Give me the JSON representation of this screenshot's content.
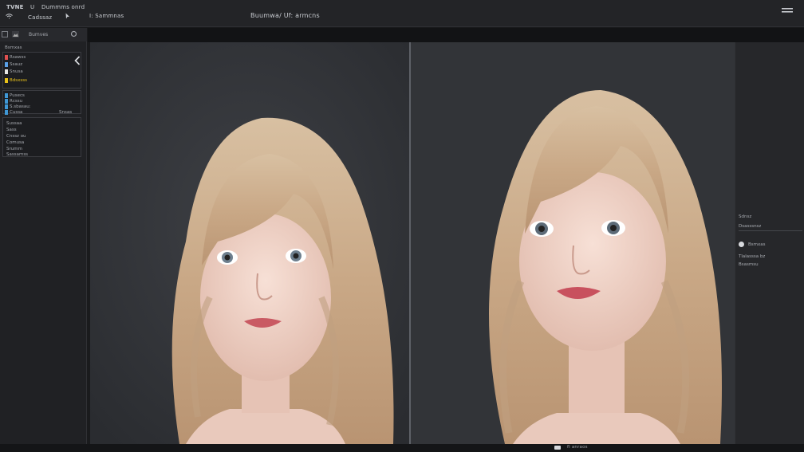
{
  "topbar": {
    "app_name": "TVNE",
    "menu_u": "U",
    "menu_title": "Dummms onrd",
    "sub_label": "Cadssaz",
    "tool_label": "I: Sammnas",
    "doc_title": "Buumwa/ Uf: armcns",
    "menu_icon": "hamburger-menu-icon"
  },
  "left_panel": {
    "header_label": "Bumves",
    "section_label": "Bsmxas",
    "layers": [
      {
        "label": "Rsawss",
        "color": "#e05050"
      },
      {
        "label": "Ssauz",
        "color": "#5aa0e6"
      },
      {
        "label": "Snusa",
        "color": "#e6e6e6"
      },
      {
        "label": "Bdsxsss",
        "color": "#e8c21a"
      },
      {
        "label": "Pusecs",
        "color": "#3f98d6"
      },
      {
        "label": "Rcssu",
        "color": "#3f98d6"
      },
      {
        "label": "S.sbasau:",
        "color": "#3f98d6"
      },
      {
        "label": "Cussa",
        "color": "#3f98d6"
      }
    ],
    "right_value": "Snsas",
    "props": [
      "Sussaa",
      "Sass",
      "Cnssz  ou",
      "Comusa",
      "Srumm",
      "Sassamss"
    ]
  },
  "right_panel": {
    "title": "Sdnsz",
    "field": "Dsasssnsz",
    "option": "Bsmxas",
    "row1": "Tlalasssa  bz",
    "row2": "Bsasmsu"
  },
  "bottom": {
    "status": "fl anraos"
  },
  "colors": {
    "accent": "#e8c21a",
    "layer_blue": "#3f98d6",
    "canvas_bg": "#2e3033"
  }
}
